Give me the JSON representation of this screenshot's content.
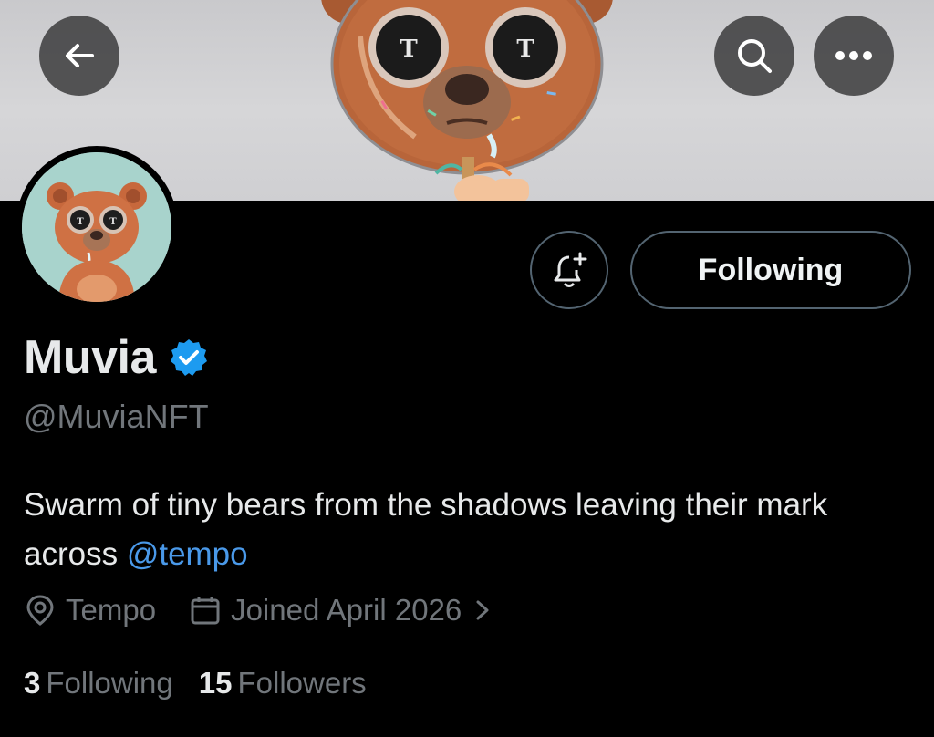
{
  "profile": {
    "name": "Muvia",
    "handle": "@MuviaNFT",
    "bio_text": "Swarm of tiny bears from the shadows leaving their mark across ",
    "bio_mention": "@tempo",
    "location": "Tempo",
    "joined": "Joined April 2026",
    "following_count": "3",
    "following_label": "Following",
    "followers_count": "15",
    "followers_label": "Followers"
  },
  "actions": {
    "follow_state_label": "Following"
  },
  "icons": {
    "back": "arrow-left-icon",
    "search": "search-icon",
    "more": "more-dots-icon",
    "notify": "bell-plus-icon",
    "verified": "verified-badge-icon",
    "location": "location-pin-icon",
    "calendar": "calendar-icon",
    "chevron": "chevron-right-icon"
  },
  "colors": {
    "background": "#000000",
    "accent_link": "#4a99e9",
    "verified_blue": "#1d9bf0",
    "muted_text": "#71767b"
  }
}
